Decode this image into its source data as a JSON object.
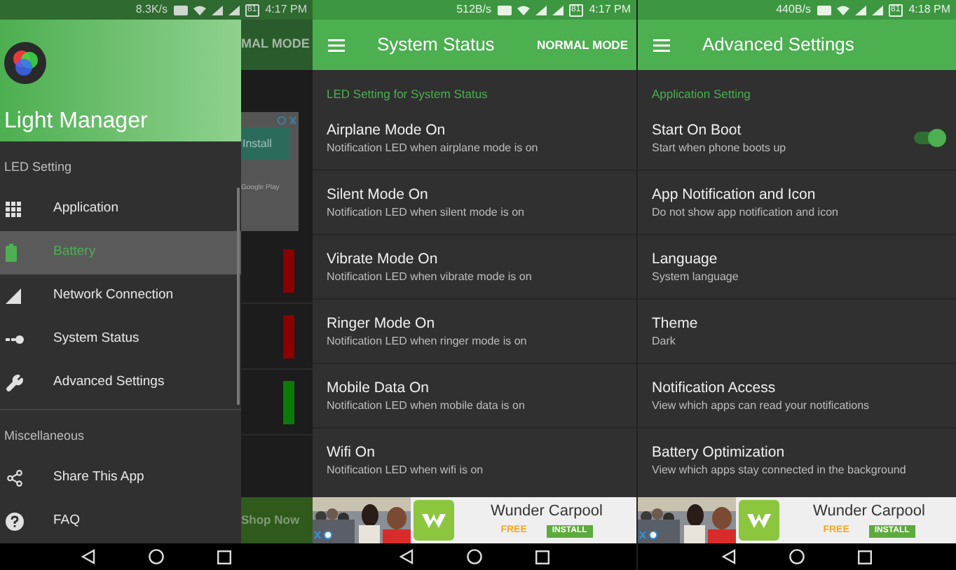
{
  "screens": [
    {
      "kind": "drawer",
      "status_bar": {
        "speed": "8.3K/s",
        "battery": "81",
        "time": "4:17 PM"
      },
      "background": {
        "toolbar_text": "MAL MODE",
        "ad_button": "Install",
        "ad_store": "Google Play",
        "bars": [
          {
            "color": "#8b0000"
          },
          {
            "color": "#8b0000"
          },
          {
            "color": "#0a7a0a"
          }
        ],
        "banner_button": "Shop Now"
      },
      "drawer": {
        "app_name": "Light Manager",
        "sections": [
          {
            "title": "LED Setting",
            "items": [
              {
                "label": "Application",
                "kind": "grid",
                "selected": false
              },
              {
                "label": "Battery",
                "kind": "battery",
                "selected": true
              },
              {
                "label": "Network Connection",
                "kind": "signal",
                "selected": false
              },
              {
                "label": "System Status",
                "kind": "status",
                "selected": false
              },
              {
                "label": "Advanced Settings",
                "kind": "wrench",
                "selected": false
              }
            ]
          },
          {
            "title": "Miscellaneous",
            "items": [
              {
                "label": "Share This App",
                "kind": "share",
                "selected": false
              },
              {
                "label": "FAQ",
                "kind": "help",
                "selected": false
              }
            ]
          }
        ]
      }
    },
    {
      "kind": "list",
      "status_bar": {
        "speed": "512B/s",
        "battery": "81",
        "time": "4:17 PM"
      },
      "toolbar": {
        "title": "System Status",
        "action": "NORMAL MODE"
      },
      "section": "LED Setting for System Status",
      "items": [
        {
          "kind": "plain",
          "title": "Airplane Mode On",
          "subtitle": "Notification LED when airplane mode is on"
        },
        {
          "kind": "plain",
          "title": "Silent Mode On",
          "subtitle": "Notification LED when silent mode is on"
        },
        {
          "kind": "plain",
          "title": "Vibrate Mode On",
          "subtitle": "Notification LED when vibrate mode is on"
        },
        {
          "kind": "plain",
          "title": "Ringer Mode On",
          "subtitle": "Notification LED when ringer mode is on"
        },
        {
          "kind": "plain",
          "title": "Mobile Data On",
          "subtitle": "Notification LED when mobile data is on"
        },
        {
          "kind": "plain",
          "title": "Wifi On",
          "subtitle": "Notification LED when wifi is on"
        }
      ],
      "ad": {
        "name": "Wunder Carpool",
        "price": "FREE",
        "button": "INSTALL"
      }
    },
    {
      "kind": "list",
      "status_bar": {
        "speed": "440B/s",
        "battery": "81",
        "time": "4:18 PM"
      },
      "toolbar": {
        "title": "Advanced Settings"
      },
      "section": "Application Setting",
      "items": [
        {
          "kind": "toggle",
          "on": true,
          "title": "Start On Boot",
          "subtitle": "Start when phone boots up"
        },
        {
          "kind": "plain",
          "title": "App Notification and Icon",
          "subtitle": "Do not show app notification and icon"
        },
        {
          "kind": "plain",
          "title": "Language",
          "subtitle": "System language"
        },
        {
          "kind": "plain",
          "title": "Theme",
          "subtitle": "Dark"
        },
        {
          "kind": "plain",
          "title": "Notification Access",
          "subtitle": "View which apps can read your notifications"
        },
        {
          "kind": "plain",
          "title": "Battery Optimization",
          "subtitle": "View which apps stay connected in the background"
        }
      ],
      "ad": {
        "name": "Wunder Carpool",
        "price": "FREE",
        "button": "INSTALL"
      }
    }
  ]
}
